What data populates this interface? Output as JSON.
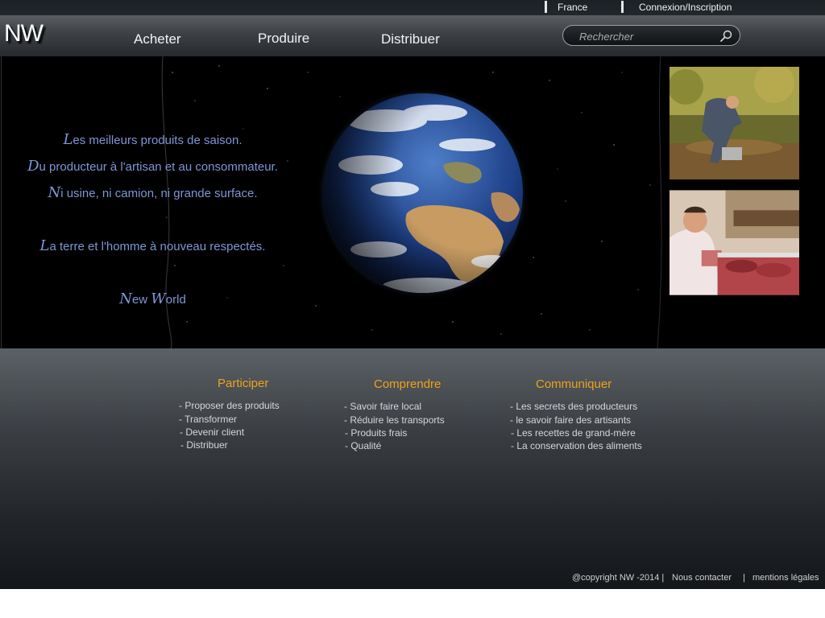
{
  "topbar": {
    "country": "France",
    "login": "Connexion/Inscription"
  },
  "header": {
    "logo": "NW",
    "nav": [
      "Acheter",
      "Produire",
      "Distribuer"
    ],
    "search_placeholder": "Rechercher"
  },
  "hero": {
    "lines": [
      {
        "cap": "L",
        "rest": "es meilleurs produits de saison."
      },
      {
        "cap": "D",
        "rest": "u producteur à l'artisan et au  consommateur."
      },
      {
        "cap": "N",
        "rest": "i usine, ni camion, ni grande surface."
      },
      {
        "cap": "L",
        "rest": "a terre et l'homme  à nouveau respectés."
      }
    ],
    "signature": {
      "cap1": "N",
      "rest1": "ew ",
      "cap2": "W",
      "rest2": "orld"
    }
  },
  "columns": [
    {
      "title": "Participer",
      "links": [
        "- Proposer des produits",
        "- Transformer",
        "- Devenir client",
        "- Distribuer"
      ]
    },
    {
      "title": "Comprendre",
      "links": [
        "- Savoir faire local",
        "- Réduire les transports",
        "- Produits frais",
        "- Qualité"
      ]
    },
    {
      "title": "Communiquer",
      "links": [
        "- Les secrets des producteurs",
        "- le savoir faire des artisants",
        "- Les recettes de grand-mère",
        "- La conservation des aliments"
      ]
    }
  ],
  "footer": {
    "copyright": "@copyright NW -2014 |",
    "contact": "Nous contacter",
    "separator": "|",
    "legal": "mentions légales"
  },
  "colors": {
    "accent": "#f0a21a",
    "tagline": "#7d96d6",
    "background": "#000000"
  }
}
